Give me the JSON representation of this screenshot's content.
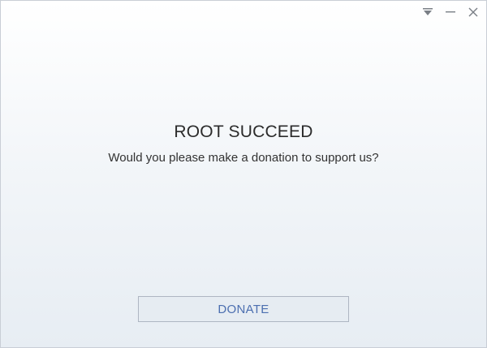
{
  "window": {
    "controls": [
      {
        "icon": "dropdown-menu-icon"
      },
      {
        "icon": "minimize-icon"
      },
      {
        "icon": "close-icon"
      }
    ]
  },
  "dialog": {
    "title": "ROOT SUCCEED",
    "message": "Would you please make a donation to support us?",
    "donate_label": "DONATE"
  },
  "colors": {
    "button_text": "#4c6fb0",
    "button_border": "#aeb6c2",
    "background_top": "#ffffff",
    "background_bottom": "#e7edf3"
  }
}
